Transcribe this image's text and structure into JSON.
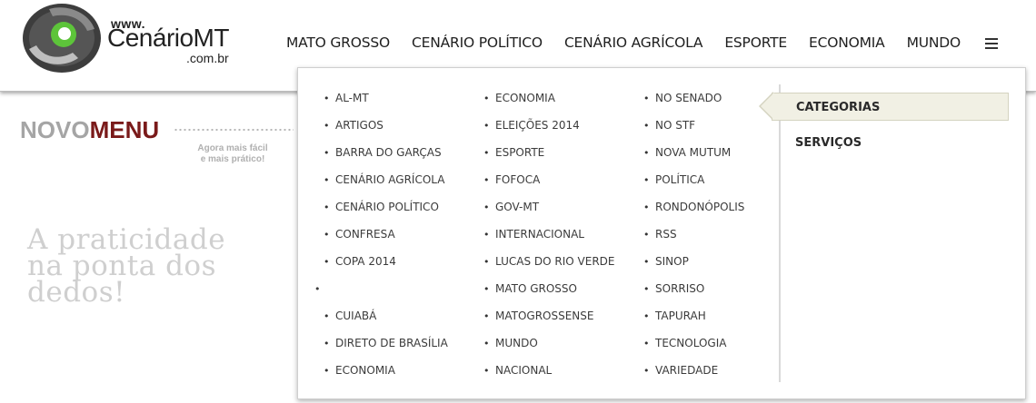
{
  "logo": {
    "www": "www.",
    "name": "CenárioMT",
    "domain": ".com.br"
  },
  "topnav": [
    "MATO GROSSO",
    "CENÁRIO POLÍTICO",
    "CENÁRIO AGRÍCOLA",
    "ESPORTE",
    "ECONOMIA",
    "MUNDO"
  ],
  "promo": {
    "novo": "NOVO",
    "menu": "MENU",
    "sub_line1": "Agora mais fácil",
    "sub_line2": "e mais prático!",
    "tagline": "A praticidade na ponta dos dedos!"
  },
  "mega_menu": {
    "col1": [
      "AL-MT",
      "ARTIGOS",
      "BARRA DO GARÇAS",
      "CENÁRIO AGRÍCOLA",
      "CENÁRIO POLÍTICO",
      "CONFRESA",
      "COPA 2014",
      "",
      "CUIABÁ",
      "DIRETO DE BRASÍLIA",
      "ECONOMIA"
    ],
    "col2": [
      "ECONOMIA",
      "ELEIÇÕES 2014",
      "ESPORTE",
      "FOFOCA",
      "GOV-MT",
      "INTERNACIONAL",
      "LUCAS DO RIO VERDE",
      "MATO GROSSO",
      "MATOGROSSENSE",
      "MUNDO",
      "NACIONAL"
    ],
    "col3": [
      "NO SENADO",
      "NO STF",
      "NOVA MUTUM",
      "POLÍTICA",
      "RONDONÓPOLIS",
      "RSS",
      "SINOP",
      "SORRISO",
      "TAPURAH",
      "TECNOLOGIA",
      "VARIEDADE"
    ],
    "tabs": [
      "CATEGORIAS",
      "SERVIÇOS"
    ]
  },
  "colors": {
    "menu_accent": "#7a1a1a",
    "tab_active_bg": "#f1f0e4",
    "logo_green": "#5dc43a",
    "logo_dark": "#3d3d3d"
  },
  "icons": [
    "logo-mark",
    "hamburger-icon",
    "bullet-icon"
  ]
}
